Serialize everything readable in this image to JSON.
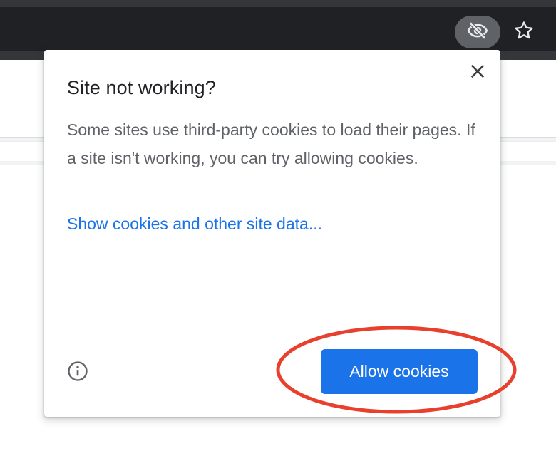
{
  "browser": {
    "toolbar": {
      "tracking_icon": "eye-slash-icon",
      "bookmark_icon": "star-icon"
    }
  },
  "dialog": {
    "title": "Site not working?",
    "body": "Some sites use third-party cookies to load their pages. If a site isn't working, you can try allowing cookies.",
    "link": "Show cookies and other site data...",
    "primary_button": "Allow cookies",
    "close_icon": "close-icon",
    "info_icon": "info-icon"
  },
  "colors": {
    "chrome_dark": "#35363a",
    "omnibox": "#202124",
    "accent": "#1a73e8",
    "annotation": "#e8402c",
    "body_text": "#5f6368",
    "title_text": "#202124"
  }
}
